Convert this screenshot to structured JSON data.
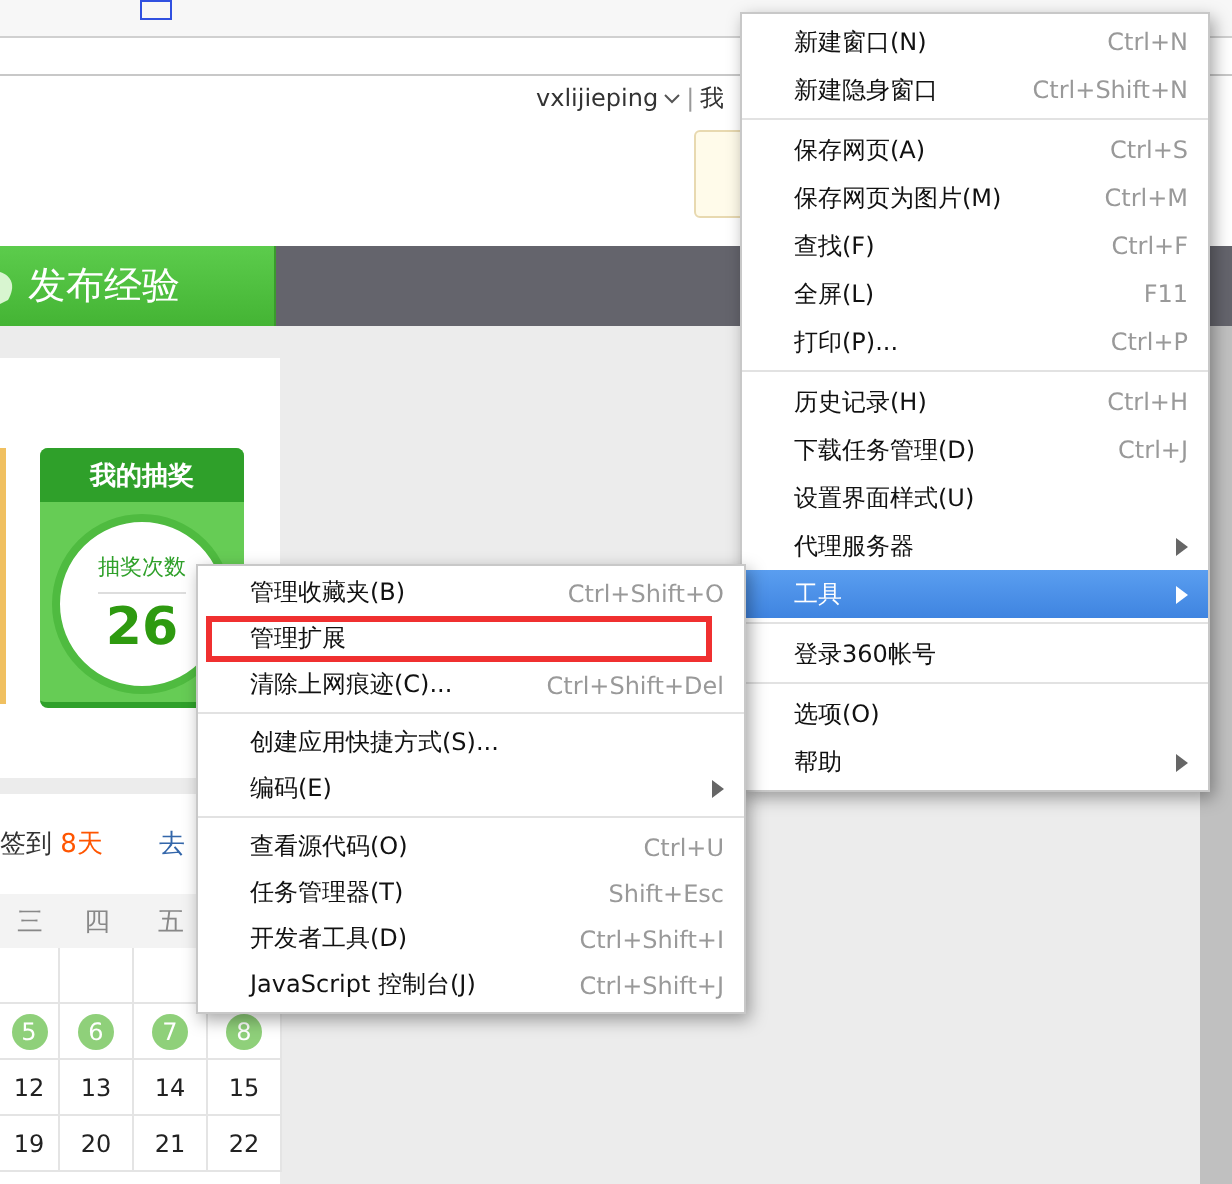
{
  "header": {
    "username": "vxlijieping",
    "separator": "|",
    "next_link": "我"
  },
  "nav": {
    "publish_button": "发布经验"
  },
  "lottery_card": {
    "title": "我的抽奖",
    "caption": "抽奖次数",
    "count": "26"
  },
  "checkin": {
    "label": "签到",
    "days": "8天",
    "link": "去"
  },
  "calendar": {
    "weekdays": [
      "三",
      "四",
      "五"
    ],
    "weeks": [
      {
        "blank": true
      },
      {
        "days": [
          {
            "label": "5",
            "signed": true
          },
          {
            "label": "6",
            "signed": true
          },
          {
            "label": "7",
            "signed": true
          },
          {
            "label": "8",
            "signed": true
          }
        ]
      },
      {
        "days": [
          {
            "label": "12",
            "signed": false
          },
          {
            "label": "13",
            "signed": false
          },
          {
            "label": "14",
            "signed": false
          },
          {
            "label": "15",
            "signed": false
          }
        ]
      },
      {
        "days": [
          {
            "label": "19",
            "signed": false
          },
          {
            "label": "20",
            "signed": false
          },
          {
            "label": "21",
            "signed": false
          },
          {
            "label": "22",
            "signed": false
          }
        ]
      }
    ]
  },
  "main_menu": [
    {
      "kind": "item",
      "label": "新建窗口(N)",
      "shortcut": "Ctrl+N",
      "submenu": false,
      "selected": false
    },
    {
      "kind": "item",
      "label": "新建隐身窗口",
      "shortcut": "Ctrl+Shift+N",
      "submenu": false,
      "selected": false
    },
    {
      "kind": "separator"
    },
    {
      "kind": "item",
      "label": "保存网页(A)",
      "shortcut": "Ctrl+S",
      "submenu": false,
      "selected": false
    },
    {
      "kind": "item",
      "label": "保存网页为图片(M)",
      "shortcut": "Ctrl+M",
      "submenu": false,
      "selected": false
    },
    {
      "kind": "item",
      "label": "查找(F)",
      "shortcut": "Ctrl+F",
      "submenu": false,
      "selected": false
    },
    {
      "kind": "item",
      "label": "全屏(L)",
      "shortcut": "F11",
      "submenu": false,
      "selected": false
    },
    {
      "kind": "item",
      "label": "打印(P)...",
      "shortcut": "Ctrl+P",
      "submenu": false,
      "selected": false
    },
    {
      "kind": "separator"
    },
    {
      "kind": "item",
      "label": "历史记录(H)",
      "shortcut": "Ctrl+H",
      "submenu": false,
      "selected": false
    },
    {
      "kind": "item",
      "label": "下载任务管理(D)",
      "shortcut": "Ctrl+J",
      "submenu": false,
      "selected": false
    },
    {
      "kind": "item",
      "label": "设置界面样式(U)",
      "submenu": false,
      "selected": false
    },
    {
      "kind": "item",
      "label": "代理服务器",
      "submenu": true,
      "selected": false
    },
    {
      "kind": "item",
      "label": "工具",
      "submenu": true,
      "selected": true
    },
    {
      "kind": "separator"
    },
    {
      "kind": "item",
      "label": "登录360帐号",
      "submenu": false,
      "selected": false
    },
    {
      "kind": "separator"
    },
    {
      "kind": "item",
      "label": "选项(O)",
      "submenu": false,
      "selected": false
    },
    {
      "kind": "item",
      "label": "帮助",
      "submenu": true,
      "selected": false
    }
  ],
  "tools_menu": [
    {
      "kind": "item",
      "label": "管理收藏夹(B)",
      "shortcut": "Ctrl+Shift+O",
      "submenu": false,
      "highlighted": false
    },
    {
      "kind": "item",
      "label": "管理扩展",
      "submenu": false,
      "highlighted": true
    },
    {
      "kind": "item",
      "label": "清除上网痕迹(C)...",
      "shortcut": "Ctrl+Shift+Del",
      "submenu": false,
      "highlighted": false
    },
    {
      "kind": "separator"
    },
    {
      "kind": "item",
      "label": "创建应用快捷方式(S)...",
      "submenu": false,
      "highlighted": false
    },
    {
      "kind": "item",
      "label": "编码(E)",
      "submenu": true,
      "highlighted": false
    },
    {
      "kind": "separator"
    },
    {
      "kind": "item",
      "label": "查看源代码(O)",
      "shortcut": "Ctrl+U",
      "submenu": false,
      "highlighted": false
    },
    {
      "kind": "item",
      "label": "任务管理器(T)",
      "shortcut": "Shift+Esc",
      "submenu": false,
      "highlighted": false
    },
    {
      "kind": "item",
      "label": "开发者工具(D)",
      "shortcut": "Ctrl+Shift+I",
      "submenu": false,
      "highlighted": false
    },
    {
      "kind": "item",
      "label": "JavaScript 控制台(J)",
      "shortcut": "Ctrl+Shift+J",
      "submenu": false,
      "highlighted": false
    }
  ]
}
